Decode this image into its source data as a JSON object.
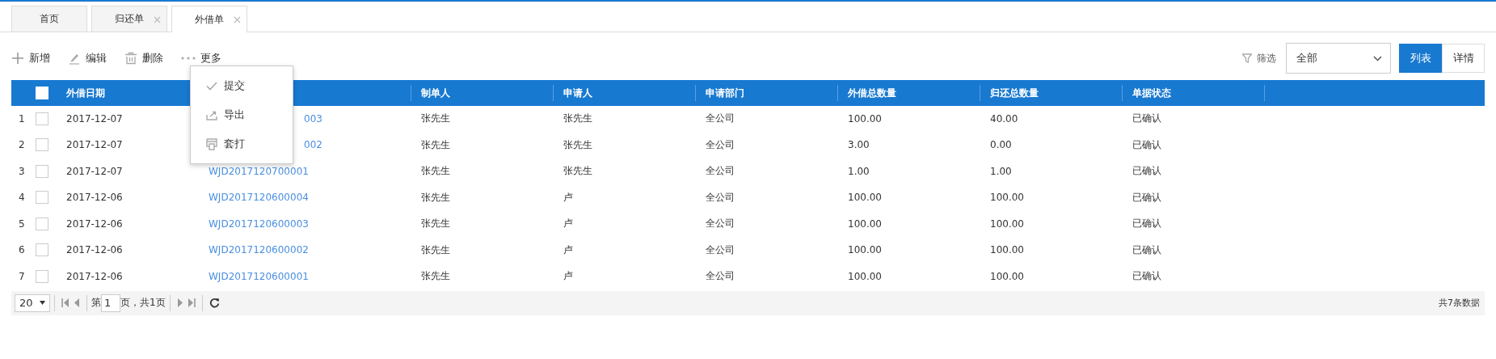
{
  "tabs": [
    {
      "label": "首页",
      "selected": false,
      "closable": false
    },
    {
      "label": "归还单",
      "selected": false,
      "closable": true
    },
    {
      "label": "外借单",
      "selected": true,
      "closable": true
    }
  ],
  "toolbar": [
    {
      "label": "新增",
      "kind": "add"
    },
    {
      "label": "编辑",
      "kind": "edit"
    },
    {
      "label": "删除",
      "kind": "delete"
    },
    {
      "label": "更多",
      "kind": "more"
    }
  ],
  "more_menu": [
    {
      "label": "提交",
      "kind": "submit"
    },
    {
      "label": "导出",
      "kind": "export"
    },
    {
      "label": "套打",
      "kind": "print"
    }
  ],
  "filter": {
    "label": "筛选",
    "value": "全部"
  },
  "views": [
    {
      "label": "列表",
      "selected": true
    },
    {
      "label": "详情",
      "selected": false
    }
  ],
  "table": {
    "header_checked": false,
    "columns": [
      "外借日期",
      "",
      "制单人",
      "申请人",
      "申请部门",
      "外借总数量",
      "归还总数量",
      "单据状态"
    ],
    "rows": [
      {
        "index": "1",
        "checked": false,
        "cells": [
          "2017-12-07",
          "003",
          "张先生",
          "张先生",
          "全公司",
          "100.00",
          "40.00",
          "已确认"
        ],
        "covered": true
      },
      {
        "index": "2",
        "checked": false,
        "cells": [
          "2017-12-07",
          "002",
          "张先生",
          "张先生",
          "全公司",
          "3.00",
          "0.00",
          "已确认"
        ],
        "covered": true
      },
      {
        "index": "3",
        "checked": false,
        "cells": [
          "2017-12-07",
          "WJD2017120700001",
          "张先生",
          "张先生",
          "全公司",
          "1.00",
          "1.00",
          "已确认"
        ]
      },
      {
        "index": "4",
        "checked": false,
        "cells": [
          "2017-12-06",
          "WJD2017120600004",
          "张先生",
          "卢",
          "全公司",
          "100.00",
          "100.00",
          "已确认"
        ]
      },
      {
        "index": "5",
        "checked": false,
        "cells": [
          "2017-12-06",
          "WJD2017120600003",
          "张先生",
          "卢",
          "全公司",
          "100.00",
          "100.00",
          "已确认"
        ]
      },
      {
        "index": "6",
        "checked": false,
        "cells": [
          "2017-12-06",
          "WJD2017120600002",
          "张先生",
          "卢",
          "全公司",
          "100.00",
          "100.00",
          "已确认"
        ]
      },
      {
        "index": "7",
        "checked": false,
        "cells": [
          "2017-12-06",
          "WJD2017120600001",
          "张先生",
          "卢",
          "全公司",
          "100.00",
          "100.00",
          "已确认"
        ]
      }
    ]
  },
  "pager": {
    "page_size": "20",
    "page_prefix": "第",
    "page": "1",
    "page_suffix": "页，共1页",
    "summary": "共7条数据"
  }
}
